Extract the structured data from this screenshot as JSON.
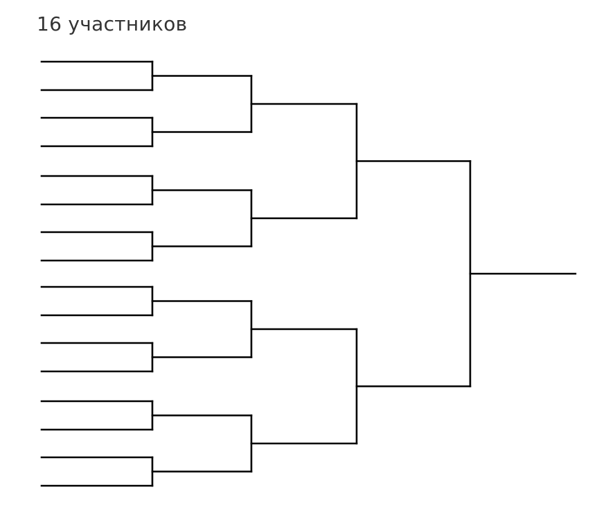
{
  "title": "16 участников",
  "bracket": {
    "participants": 16,
    "rounds": 4,
    "line_color": "#000000"
  }
}
